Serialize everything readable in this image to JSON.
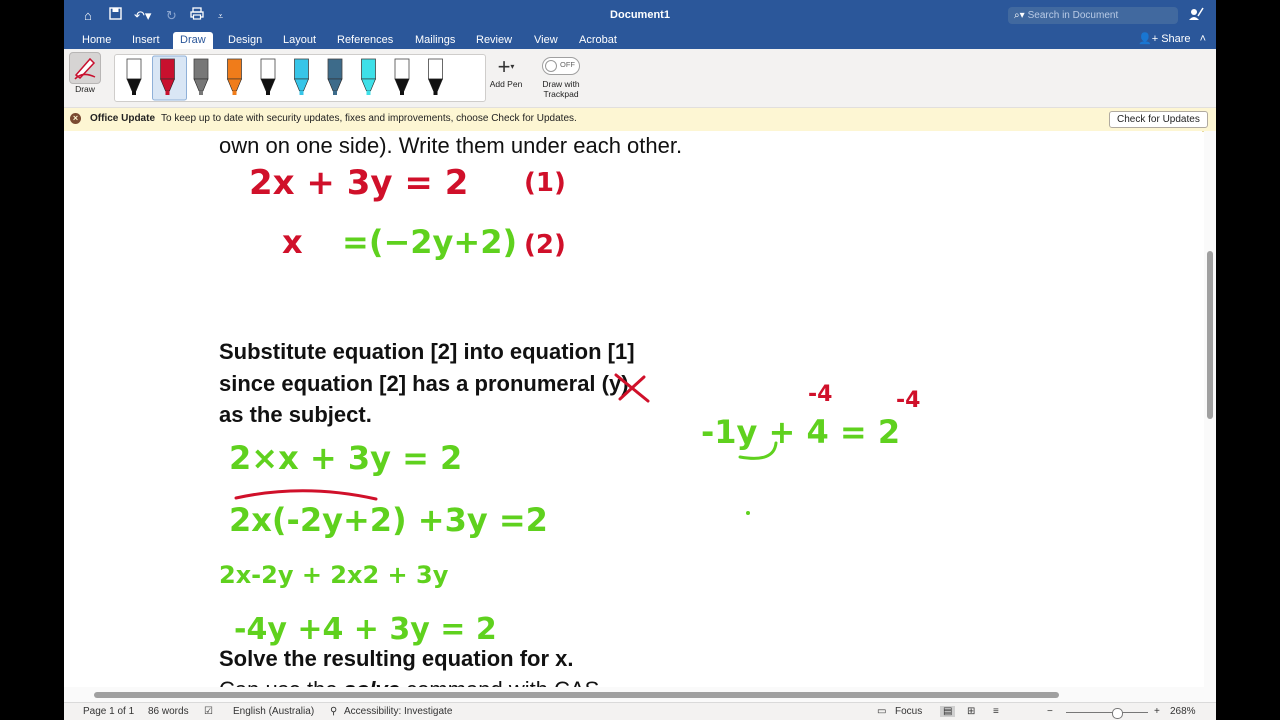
{
  "window": {
    "title": "Document1"
  },
  "search": {
    "placeholder": "Search in Document"
  },
  "tabs": [
    "Home",
    "Insert",
    "Draw",
    "Design",
    "Layout",
    "References",
    "Mailings",
    "Review",
    "View",
    "Acrobat"
  ],
  "active_tab": "Draw",
  "share_label": "Share",
  "ribbon": {
    "draw_label": "Draw",
    "add_pen_label": "Add Pen",
    "trackpad_label_1": "Draw with",
    "trackpad_label_2": "Trackpad",
    "toggle_state": "OFF",
    "pens": [
      {
        "name": "pen-black",
        "color": "#111111"
      },
      {
        "name": "pen-red",
        "color": "#c8102e"
      },
      {
        "name": "pen-gray-pencil",
        "color": "#777777"
      },
      {
        "name": "highlighter-orange",
        "color": "#f07c1a"
      },
      {
        "name": "pen-black-2",
        "color": "#111111"
      },
      {
        "name": "pen-cyan",
        "color": "#37c5e8"
      },
      {
        "name": "pen-galaxy",
        "color": "#3d6b8a"
      },
      {
        "name": "highlighter-cyan",
        "color": "#3ee0e8"
      },
      {
        "name": "pencil-black",
        "color": "#111111"
      },
      {
        "name": "pen-black-3",
        "color": "#111111"
      }
    ]
  },
  "message_bar": {
    "title": "Office Update",
    "text": "To keep up to date with security updates, fixes and improvements, choose Check for Updates.",
    "button": "Check for Updates"
  },
  "document": {
    "line1": "own on one side). Write them under each other.",
    "para2_line1": "Substitute equation [2] into equation [1]",
    "para2_line2": "since equation [2] has a pronumeral (y)",
    "para2_line3": "as the subject.",
    "line_solve": "Solve the resulting equation for x.",
    "line_cas_a": "Can use the ",
    "line_cas_b": "solve",
    "line_cas_c": " command with CAS"
  },
  "ink": {
    "red_color": "#d0102a",
    "green_color": "#5fd11e",
    "eq1": "2x + 3y = 2",
    "eq1_label": "(1)",
    "eq2_lhs": "x",
    "eq2_rhs": "=(−2y+2)",
    "eq2_label": "(2)",
    "step1": "2×x + 3y = 2",
    "step2": "2x(-2y+2) +3y =2",
    "step3": "2x-2y + 2x2 + 3y",
    "step4": "-4y +4 + 3y = 2",
    "side_eq": "-1y + 4 = 2",
    "side_sub1": "-4",
    "side_sub2": "-4"
  },
  "status": {
    "page": "Page 1 of 1",
    "words": "86 words",
    "language": "English (Australia)",
    "accessibility": "Accessibility: Investigate",
    "focus": "Focus",
    "zoom": "268%",
    "zoom_level_fraction": 0.57
  }
}
